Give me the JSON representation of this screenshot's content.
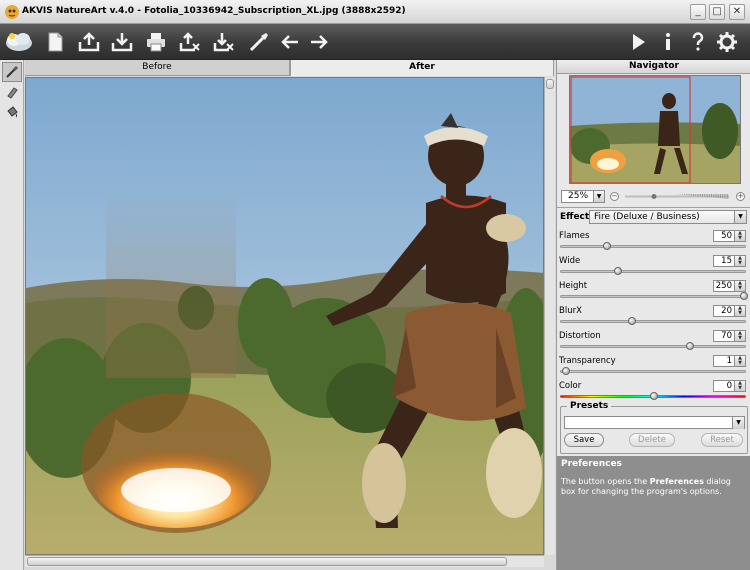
{
  "window": {
    "title": "AKVIS NatureArt v.4.0 - Fotolia_10336942_Subscription_XL.jpg (3888x2592)",
    "minimize": "_",
    "maximize": "□",
    "close": "✕"
  },
  "toolbar": {
    "left_icons": [
      "akvis-logo-icon",
      "new-icon",
      "open-icon",
      "save-icon",
      "print-icon",
      "share-upload-icon",
      "share-download-icon",
      "batch-brush-icon",
      "undo-arrow-icon",
      "redo-arrow-icon"
    ],
    "right_icons": [
      "run-play-icon",
      "info-icon",
      "help-icon",
      "settings-gear-icon"
    ]
  },
  "left_tools": [
    "brush-tool-icon",
    "eraser-tool-icon",
    "bucket-tool-icon"
  ],
  "tabs": {
    "before": "Before",
    "after": "After",
    "active": "after"
  },
  "navigator": {
    "title": "Navigator",
    "zoom": "25%",
    "zoom_slider": 0.28
  },
  "effect": {
    "label": "Effect:",
    "value": "Fire  (Deluxe / Business)"
  },
  "params": [
    {
      "label": "Flames",
      "value": "50",
      "pos": 0.24
    },
    {
      "label": "Wide",
      "value": "15",
      "pos": 0.3
    },
    {
      "label": "Height",
      "value": "250",
      "pos": 1.0
    },
    {
      "label": "BlurX",
      "value": "20",
      "pos": 0.38
    },
    {
      "label": "Distortion",
      "value": "70",
      "pos": 0.7
    },
    {
      "label": "Transparency",
      "value": "1",
      "pos": 0.01
    },
    {
      "label": "Color",
      "value": "0",
      "pos": 0.5
    }
  ],
  "presets": {
    "title": "Presets",
    "value": "",
    "save": "Save",
    "delete": "Delete",
    "reset": "Reset"
  },
  "hint": {
    "title": "Preferences",
    "text_pre": "The button opens the ",
    "text_bold": "Preferences",
    "text_post": " dialog box for changing the program's options."
  }
}
